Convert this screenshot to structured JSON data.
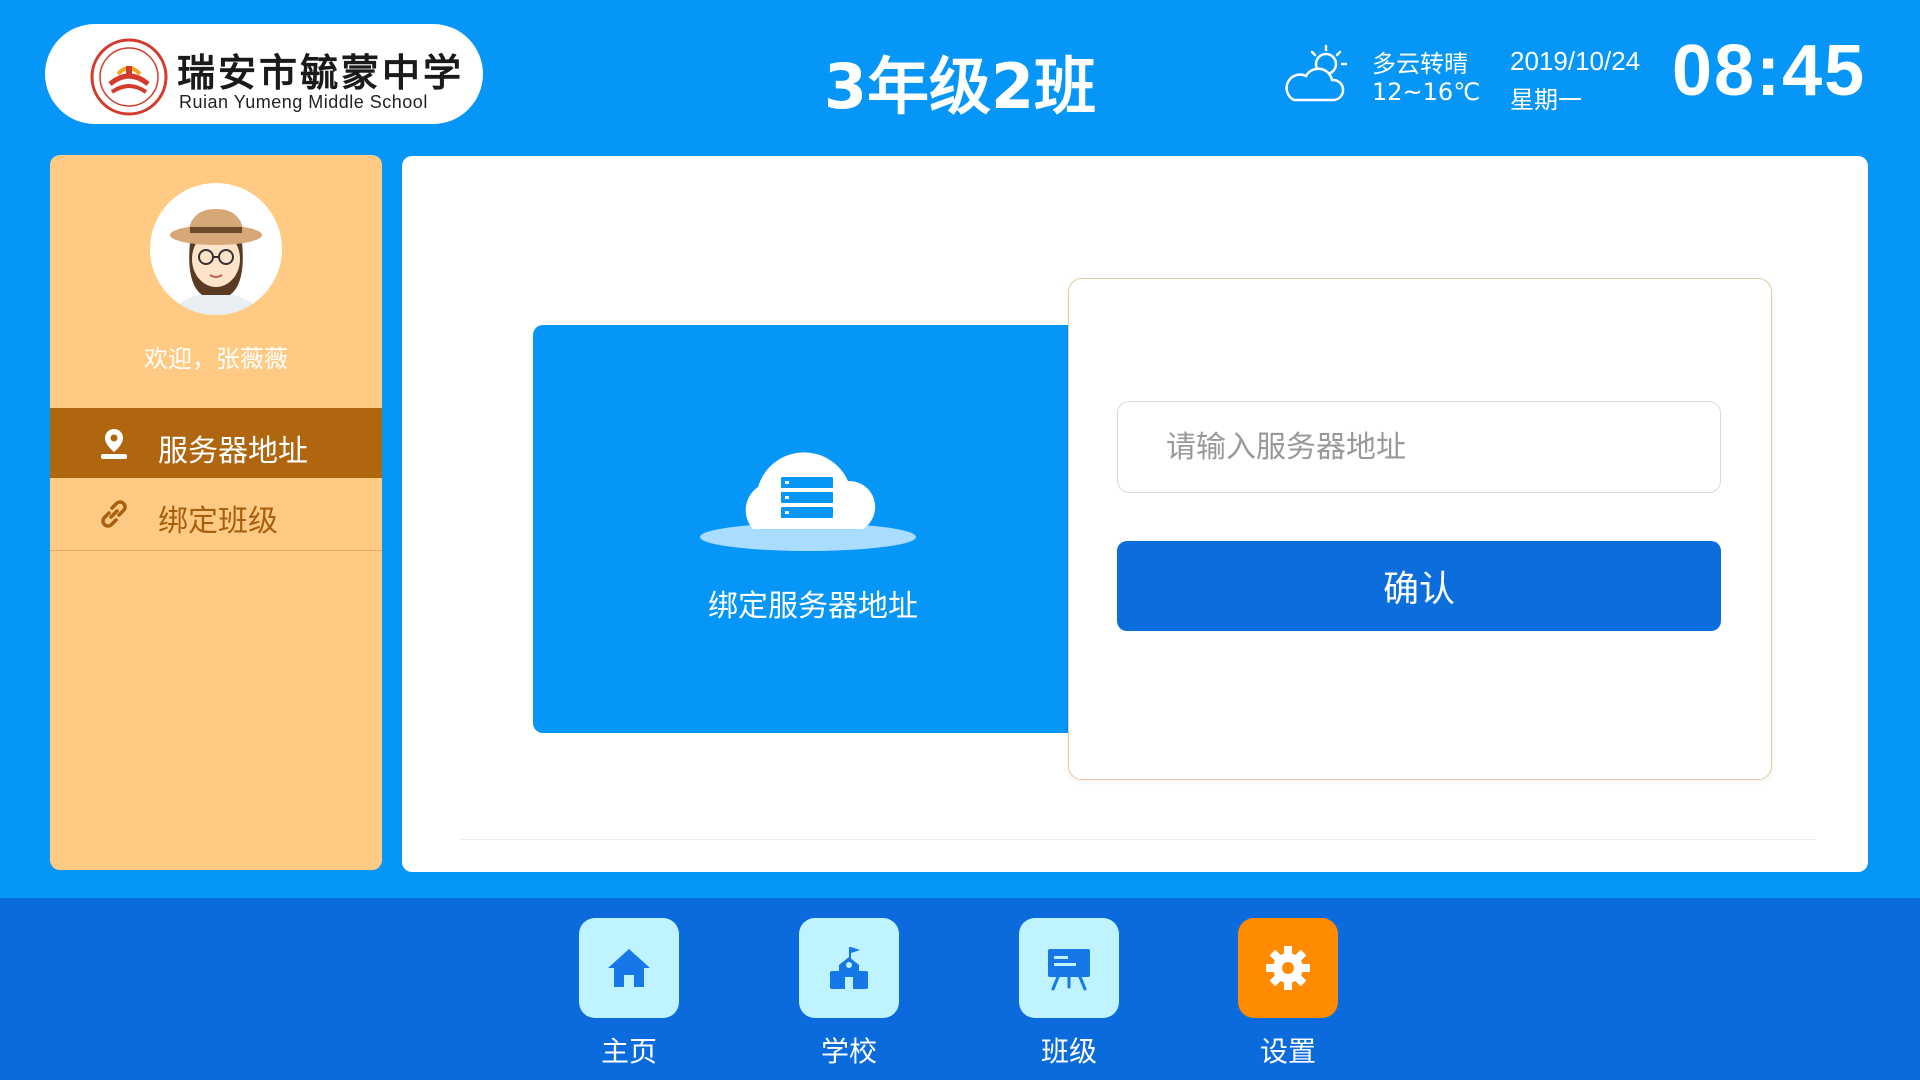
{
  "header": {
    "school_name_cn": "瑞安市毓蒙中学",
    "school_name_en": "Ruian Yumeng Middle School",
    "class_title": "3年级2班",
    "weather": {
      "icon": "partly-cloudy-icon",
      "description": "多云转晴",
      "temperature": "12~16℃"
    },
    "date": "2019/10/24",
    "weekday": "星期一",
    "time": "08:45"
  },
  "sidebar": {
    "welcome": "欢迎，张薇薇",
    "items": [
      {
        "label": "服务器地址",
        "icon": "location-pin-icon",
        "active": true
      },
      {
        "label": "绑定班级",
        "icon": "link-icon",
        "active": false
      }
    ]
  },
  "main": {
    "bind_card_label": "绑定服务器地址",
    "server_input": {
      "placeholder": "请输入服务器地址",
      "value": ""
    },
    "confirm_label": "确认"
  },
  "bottom_nav": {
    "items": [
      {
        "label": "主页",
        "icon": "home-icon",
        "active": false
      },
      {
        "label": "学校",
        "icon": "school-icon",
        "active": false
      },
      {
        "label": "班级",
        "icon": "classroom-board-icon",
        "active": false
      },
      {
        "label": "设置",
        "icon": "gear-icon",
        "active": true
      }
    ]
  },
  "colors": {
    "background": "#0596f7",
    "bottom_bar": "#0b6bdc",
    "sidebar": "#ffcb84",
    "sidebar_active": "#b0660e",
    "confirm_button": "#0c6ddc",
    "nav_tile": "#bff3ff",
    "nav_tile_active": "#ff8c00"
  }
}
